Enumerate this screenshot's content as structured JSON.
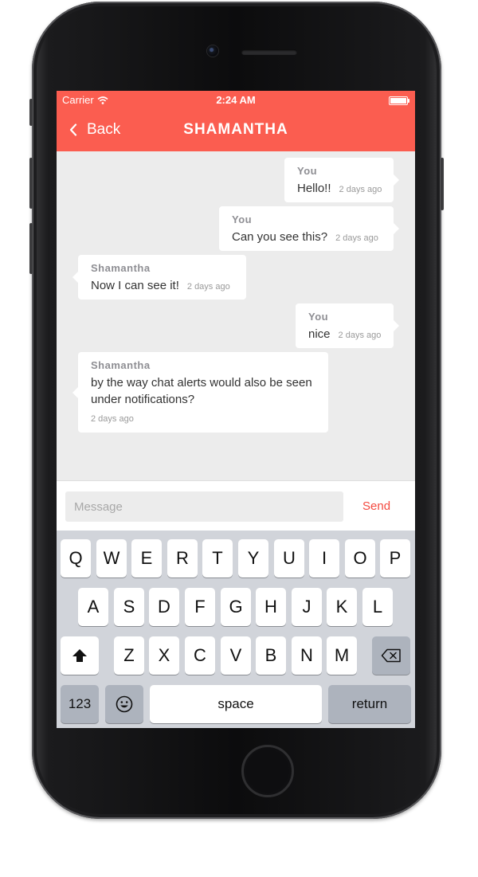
{
  "status_bar": {
    "carrier": "Carrier",
    "time": "2:24 AM"
  },
  "nav": {
    "back_label": "Back",
    "title": "SHAMANTHA"
  },
  "messages": [
    {
      "sender": "You",
      "text": "Hello!!",
      "time": "2 days ago",
      "direction": "outgoing"
    },
    {
      "sender": "You",
      "text": "Can you see this?",
      "time": "2 days ago",
      "direction": "outgoing"
    },
    {
      "sender": "Shamantha",
      "text": "Now I can see it!",
      "time": "2 days ago",
      "direction": "incoming"
    },
    {
      "sender": "You",
      "text": "nice",
      "time": "2 days ago",
      "direction": "outgoing"
    },
    {
      "sender": "Shamantha",
      "text": "by the way chat alerts would also be seen under notifications?",
      "time": "2 days ago",
      "direction": "incoming"
    }
  ],
  "composer": {
    "placeholder": "Message",
    "value": "",
    "send_label": "Send"
  },
  "keyboard": {
    "row1": [
      "Q",
      "W",
      "E",
      "R",
      "T",
      "Y",
      "U",
      "I",
      "O",
      "P"
    ],
    "row2": [
      "A",
      "S",
      "D",
      "F",
      "G",
      "H",
      "J",
      "K",
      "L"
    ],
    "row3": [
      "Z",
      "X",
      "C",
      "V",
      "B",
      "N",
      "M"
    ],
    "numbers_label": "123",
    "space_label": "space",
    "return_label": "return",
    "shift_icon": "shift-arrow",
    "delete_icon": "backspace",
    "emoji_icon": "smiley-face"
  },
  "colors": {
    "accent": "#fb5d50",
    "send": "#f4493f",
    "chat_bg": "#ececec",
    "keyboard_bg": "#d1d4da"
  }
}
